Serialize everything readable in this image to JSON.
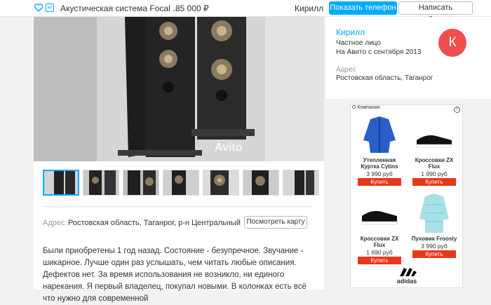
{
  "header": {
    "title": "Акустическая система Focal ...",
    "price": "85 000  ₽",
    "seller_name": "Кирилл",
    "phone_button": "Показать телефон",
    "message_button": "Написать сообщение"
  },
  "photo": {
    "watermark": "Avito",
    "thumbnails": [
      "photo-1",
      "photo-2",
      "photo-3",
      "photo-4",
      "photo-5",
      "photo-6",
      "photo-7"
    ]
  },
  "address": {
    "label": "Адрес:",
    "value": "Ростовская область, Таганрог, р-н Центральный",
    "map_button": "Посмотреть карту"
  },
  "description": "Были приобретены 1 год назад. Состояние - безупречное. Звучание - шикарное. Лучше один раз услышать, чем читать любые описания. Дефектов нет. За время использования не возникло, ни единого нарекания. Я первый владелец, покупал новыми. В колонках есть всё что нужно для современной",
  "seller": {
    "name": "Кирилл",
    "type": "Частное лицо",
    "since": "На Авито с сентября 2013",
    "avatar_letter": "К",
    "addr_label": "Адрес",
    "addr_value": "Ростовская область, Таганрог"
  },
  "ad": {
    "tag": "О Компании",
    "info": "i",
    "brand": "adidas",
    "products": [
      {
        "name": "Утепленная Куртка Cytins",
        "price": "3 990 руб",
        "buy": "Купить"
      },
      {
        "name": "Кроссовки ZX Flux",
        "price": "1 990 руб",
        "buy": "Купить"
      },
      {
        "name": "Кроссовки ZX Flux",
        "price": "1 690 руб",
        "buy": "Купить"
      },
      {
        "name": "Пуховик Froosty",
        "price": "3 990 руб",
        "buy": "Купить"
      }
    ]
  },
  "colors": {
    "accent": "#00aaff",
    "avatar": "#f04e4e",
    "buy": "#e8381a"
  }
}
